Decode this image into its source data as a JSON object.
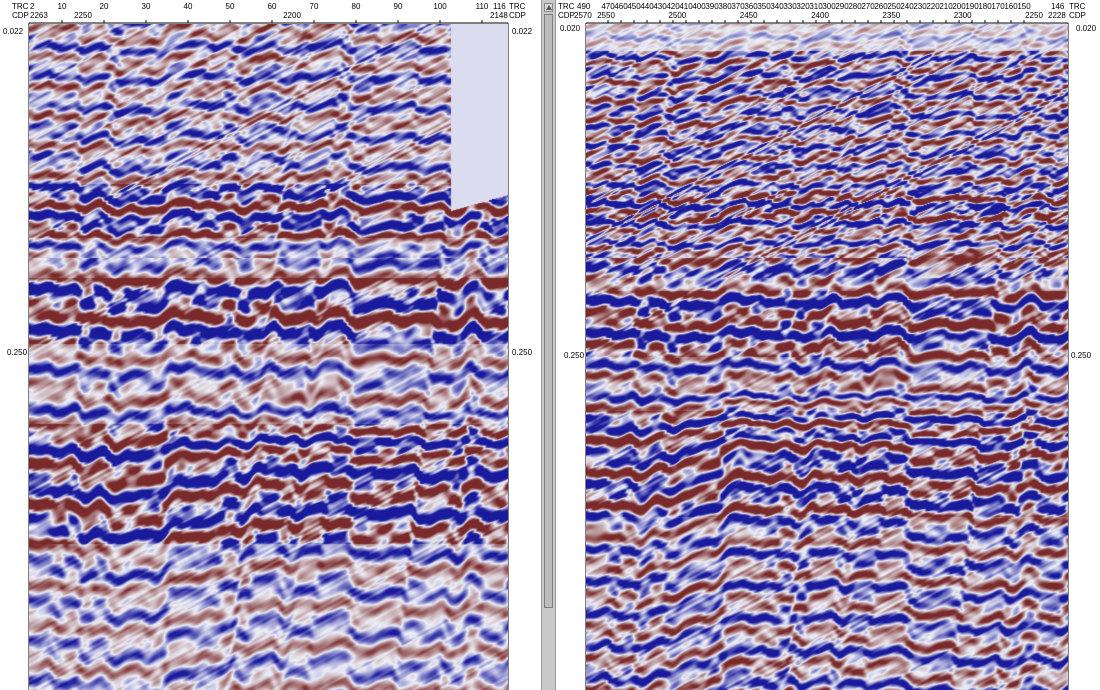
{
  "colors": {
    "trough": "#1a1a9c",
    "peak": "#7a2a2a",
    "background": "#eef0f8",
    "missing": "#dcdcf0"
  },
  "left_panel": {
    "header": {
      "trc_label": "TRC",
      "cdp_label": "CDP",
      "trc_start": "2",
      "cdp_start": "2263",
      "trc_ticks": [
        "10",
        "20",
        "30",
        "40",
        "50",
        "60",
        "70",
        "80",
        "90",
        "100",
        "110"
      ],
      "cdp_ticks": [
        "2250",
        "2200"
      ],
      "trc_end": "116",
      "cdp_end": "2148"
    },
    "time_top": "0.022",
    "time_mid": "0.250"
  },
  "right_panel": {
    "header": {
      "trc_label": "TRC",
      "cdp_label": "CDP",
      "trc_start": "490",
      "cdp_start": "2570",
      "trc_ticks": [
        "470",
        "460",
        "450",
        "440",
        "430",
        "420",
        "410",
        "400",
        "390",
        "380",
        "370",
        "360",
        "350",
        "340",
        "330",
        "320",
        "310",
        "300",
        "290",
        "280",
        "270",
        "260",
        "250",
        "240",
        "230",
        "220",
        "210",
        "200",
        "190",
        "180",
        "170",
        "160",
        "150"
      ],
      "cdp_ticks": [
        "2550",
        "2500",
        "2450",
        "2400",
        "2350",
        "2300",
        "2250"
      ],
      "trc_end": "146",
      "cdp_end": "2228"
    },
    "time_top": "0.020",
    "time_mid": "0.250"
  }
}
